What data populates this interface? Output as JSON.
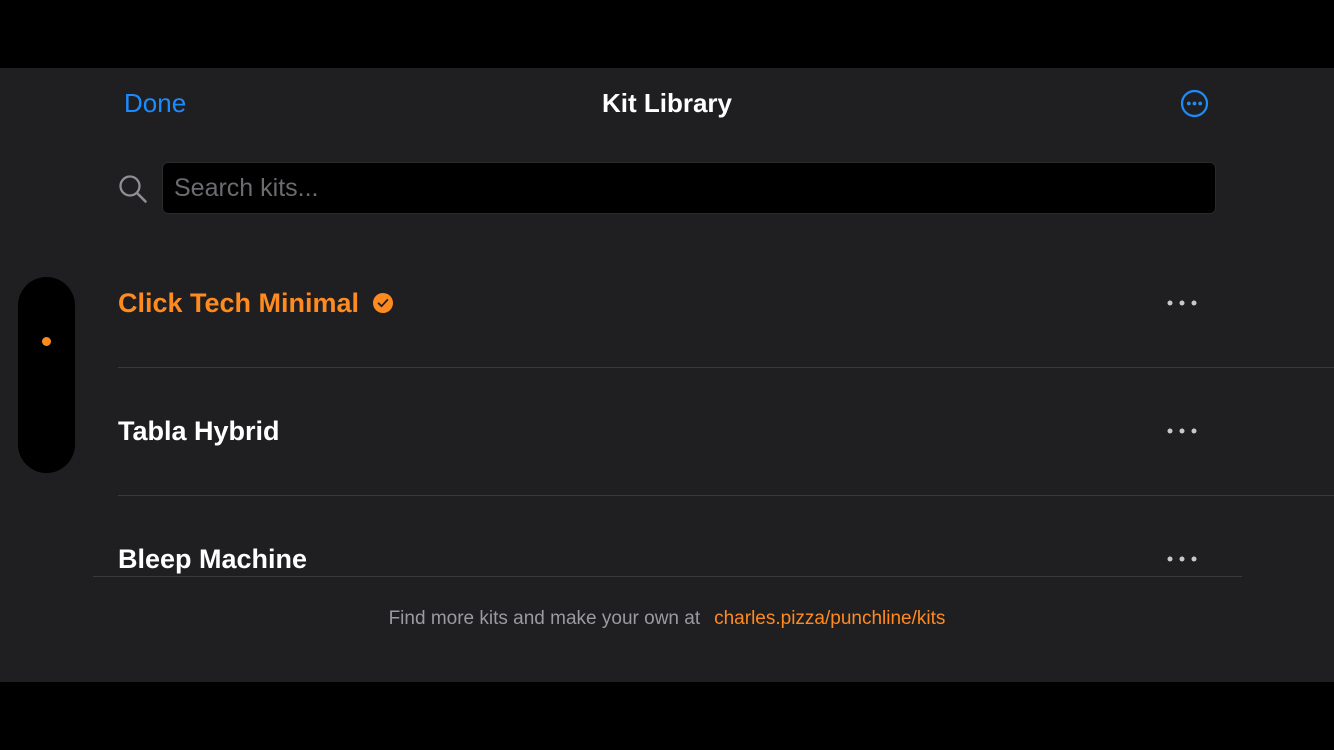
{
  "header": {
    "done_label": "Done",
    "title": "Kit Library",
    "more_icon": "ellipsis-circle-icon"
  },
  "search": {
    "placeholder": "Search kits...",
    "value": "",
    "icon": "magnifying-glass-icon"
  },
  "kits": [
    {
      "name": "Click Tech Minimal",
      "selected": true,
      "badge_icon": "checkmark-circle-icon"
    },
    {
      "name": "Tabla Hybrid",
      "selected": false
    },
    {
      "name": "Bleep Machine",
      "selected": false
    }
  ],
  "footer": {
    "text": "Find more kits and make your own at",
    "link": "charles.pizza/punchline/kits"
  },
  "colors": {
    "accent_blue": "#1a8cff",
    "accent_orange": "#ff8a1f",
    "sheet_background": "#1f1f21",
    "text_primary": "#ffffff",
    "text_secondary": "#9a9a9f"
  }
}
